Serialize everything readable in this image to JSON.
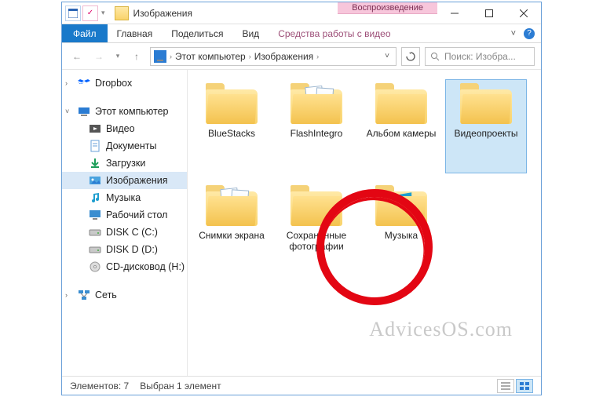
{
  "titlebar": {
    "title": "Изображения",
    "context_tab_header": "Воспроизведение"
  },
  "ribbon": {
    "file": "Файл",
    "tabs": [
      "Главная",
      "Поделиться",
      "Вид"
    ],
    "context_tab": "Средства работы с видео"
  },
  "address": {
    "crumbs": [
      "Этот компьютер",
      "Изображения"
    ],
    "search_placeholder": "Поиск: Изобра..."
  },
  "nav": {
    "items": [
      {
        "label": "Dropbox",
        "icon": "dropbox"
      },
      {
        "label": "Этот компьютер",
        "icon": "pc",
        "expanded": true
      },
      {
        "label": "Видео",
        "icon": "video",
        "level": 2
      },
      {
        "label": "Документы",
        "icon": "docs",
        "level": 2
      },
      {
        "label": "Загрузки",
        "icon": "downloads",
        "level": 2
      },
      {
        "label": "Изображения",
        "icon": "pictures",
        "level": 2,
        "selected": true
      },
      {
        "label": "Музыка",
        "icon": "music",
        "level": 2
      },
      {
        "label": "Рабочий стол",
        "icon": "desktop",
        "level": 2
      },
      {
        "label": "DISK C (C:)",
        "icon": "drive",
        "level": 2
      },
      {
        "label": "DISK D (D:)",
        "icon": "drive",
        "level": 2
      },
      {
        "label": "CD-дисковод (H:)",
        "icon": "cd",
        "level": 2
      },
      {
        "label": "Сеть",
        "icon": "network"
      }
    ]
  },
  "folders": [
    {
      "label": "BlueStacks",
      "thumbs": 0
    },
    {
      "label": "FlashIntegro",
      "thumbs": 2
    },
    {
      "label": "Альбом камеры",
      "thumbs": 0
    },
    {
      "label": "Видеопроекты",
      "thumbs": 0,
      "selected": true
    },
    {
      "label": "Снимки экрана",
      "thumbs": 2,
      "highlighted": true
    },
    {
      "label": "Сохраненные фотографии",
      "thumbs": 0
    },
    {
      "label": "Музыка",
      "music": true
    }
  ],
  "status": {
    "count_label": "Элементов: 7",
    "selection_label": "Выбран 1 элемент"
  },
  "watermark": "AdvicesOS.com"
}
